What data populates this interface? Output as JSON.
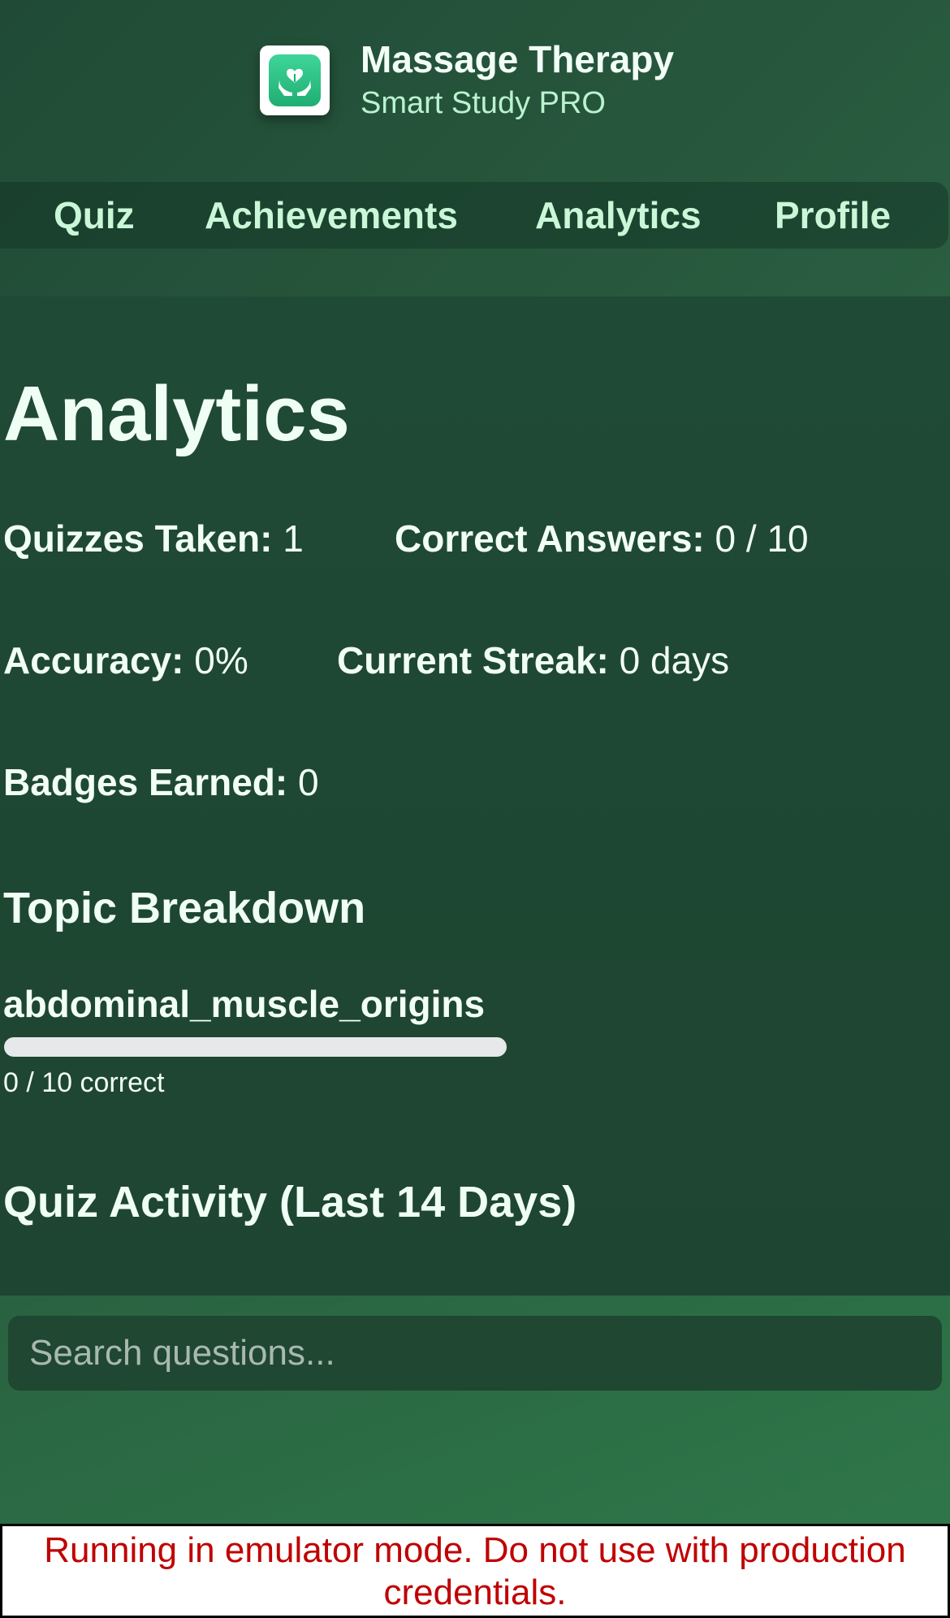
{
  "header": {
    "app_title": "Massage Therapy",
    "app_subtitle": "Smart Study PRO",
    "logo_icon": "hands-heart-icon",
    "nav": [
      {
        "label": "Quiz"
      },
      {
        "label": "Achievements"
      },
      {
        "label": "Analytics"
      },
      {
        "label": "Profile"
      }
    ]
  },
  "main": {
    "title": "Analytics",
    "stats": {
      "quizzes_taken": {
        "label": "Quizzes Taken:",
        "value": "1"
      },
      "correct_answers": {
        "label": "Correct Answers:",
        "value": "0 / 10"
      },
      "accuracy": {
        "label": "Accuracy:",
        "value": "0%"
      },
      "current_streak": {
        "label": "Current Streak:",
        "value": "0 days"
      },
      "badges_earned": {
        "label": "Badges Earned:",
        "value": "0"
      }
    },
    "topic_breakdown": {
      "heading": "Topic Breakdown",
      "topics": [
        {
          "name": "abdominal_muscle_origins",
          "caption": "0 / 10 correct",
          "progress": 0
        }
      ]
    },
    "activity": {
      "heading": "Quiz Activity (Last 14 Days)"
    }
  },
  "search": {
    "placeholder": "Search questions..."
  },
  "banner": {
    "text": "Running in emulator mode. Do not use with production credentials."
  },
  "colors": {
    "accent": "#3fd59a",
    "nav_text": "#c9f7d8",
    "banner_text": "#c00000"
  }
}
